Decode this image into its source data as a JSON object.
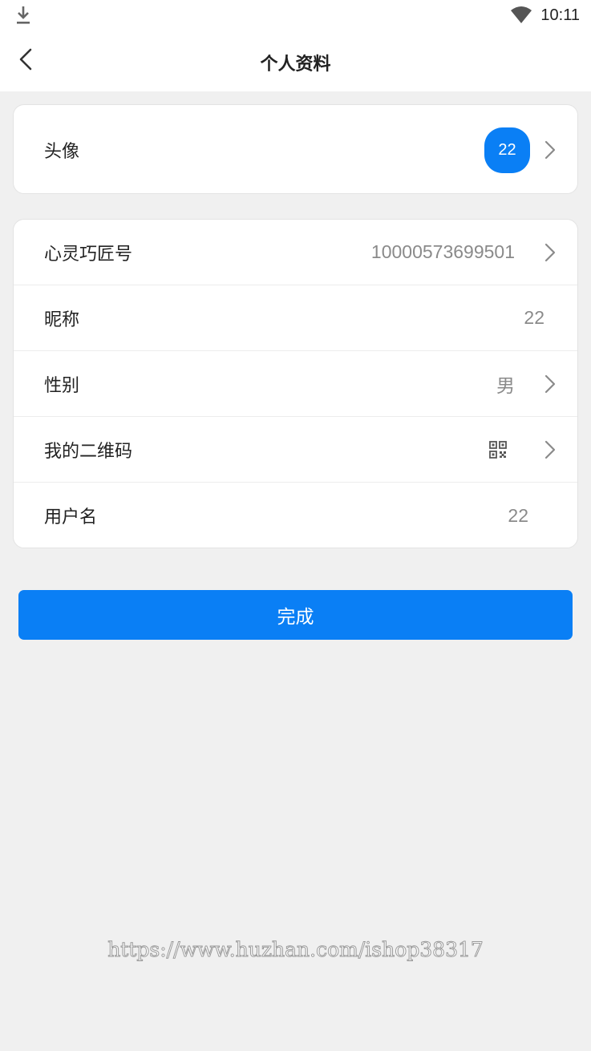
{
  "status_bar": {
    "time": "10:11",
    "icons": [
      "download-icon",
      "wifi-icon"
    ]
  },
  "header": {
    "title": "个人资料",
    "back_icon": "chevron-left-icon"
  },
  "avatar_section": {
    "label": "头像",
    "avatar_text": "22",
    "avatar_color": "#0a7ff5"
  },
  "profile_rows": [
    {
      "label": "心灵巧匠号",
      "value": "10000573699501",
      "has_arrow": true
    },
    {
      "label": "昵称",
      "value": "22",
      "has_arrow": false
    },
    {
      "label": "性别",
      "value": "男",
      "has_arrow": true
    },
    {
      "label": "我的二维码",
      "value_icon": "qr-code-icon",
      "has_arrow": true
    },
    {
      "label": "用户名",
      "value": "22",
      "has_arrow": false
    }
  ],
  "done_button": {
    "label": "完成",
    "color": "#0a7ff5"
  },
  "watermark": "https://www.huzhan.com/ishop38317",
  "colors": {
    "accent": "#0a7ff5",
    "background": "#f0f0f0",
    "card": "#ffffff",
    "secondary_text": "#8a8a8a"
  }
}
